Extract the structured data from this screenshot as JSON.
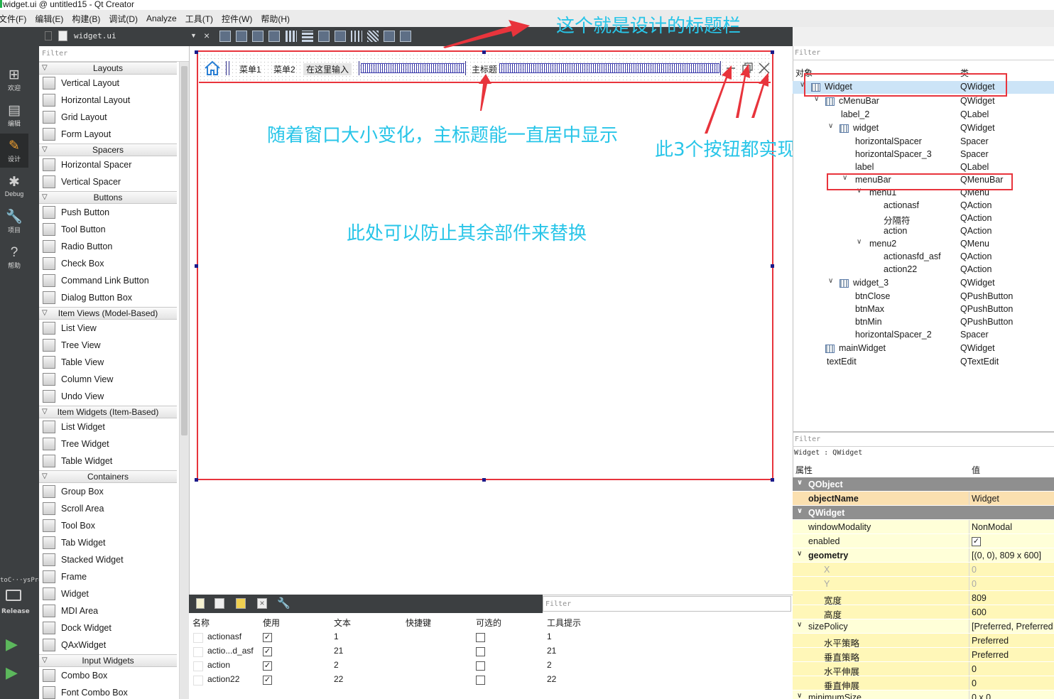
{
  "window": {
    "title": "widget.ui @ untitled15 - Qt Creator"
  },
  "menu": [
    "文件(F)",
    "编辑(E)",
    "构建(B)",
    "调试(D)",
    "Analyze",
    "工具(T)",
    "控件(W)",
    "帮助(H)"
  ],
  "modes": [
    {
      "label": "欢迎",
      "icon": "grid-icon"
    },
    {
      "label": "编辑",
      "icon": "edit-icon"
    },
    {
      "label": "设计",
      "icon": "design-pencil-icon"
    },
    {
      "label": "Debug",
      "icon": "bug-icon"
    },
    {
      "label": "项目",
      "icon": "wrench-icon"
    },
    {
      "label": "帮助",
      "icon": "help-icon"
    }
  ],
  "kit": {
    "name": "toC···ysPro",
    "config": "Release"
  },
  "toolbar": {
    "filename": "widget.ui"
  },
  "widget_box": {
    "filter_placeholder": "Filter",
    "categories": [
      {
        "name": "Layouts",
        "items": [
          "Vertical Layout",
          "Horizontal Layout",
          "Grid Layout",
          "Form Layout"
        ]
      },
      {
        "name": "Spacers",
        "items": [
          "Horizontal Spacer",
          "Vertical Spacer"
        ]
      },
      {
        "name": "Buttons",
        "items": [
          "Push Button",
          "Tool Button",
          "Radio Button",
          "Check Box",
          "Command Link Button",
          "Dialog Button Box"
        ]
      },
      {
        "name": "Item Views (Model-Based)",
        "items": [
          "List View",
          "Tree View",
          "Table View",
          "Column View",
          "Undo View"
        ]
      },
      {
        "name": "Item Widgets (Item-Based)",
        "items": [
          "List Widget",
          "Tree Widget",
          "Table Widget"
        ]
      },
      {
        "name": "Containers",
        "items": [
          "Group Box",
          "Scroll Area",
          "Tool Box",
          "Tab Widget",
          "Stacked Widget",
          "Frame",
          "Widget",
          "MDI Area",
          "Dock Widget",
          "QAxWidget"
        ]
      },
      {
        "name": "Input Widgets",
        "items": [
          "Combo Box",
          "Font Combo Box"
        ]
      }
    ]
  },
  "form": {
    "menu1": "菜单1",
    "menu2": "菜单2",
    "type_here": "在这里输入",
    "main_title": "主标题"
  },
  "annotations": {
    "title_bar": "这个就是设计的标题栏",
    "centered": "随着窗口大小变化，主标题能一直居中显示",
    "three_buttons": "此3个按钮都实现",
    "prevent_replace": "此处可以防止其余部件来替换"
  },
  "action_editor": {
    "filter_placeholder": "Filter",
    "headers": [
      "名称",
      "使用",
      "文本",
      "快捷键",
      "可选的",
      "工具提示"
    ],
    "rows": [
      {
        "name": "actionasf",
        "used": true,
        "text": "1",
        "shortcut": "",
        "checkable": false,
        "tooltip": "1"
      },
      {
        "name": "actio...d_asf",
        "used": true,
        "text": "21",
        "shortcut": "",
        "checkable": false,
        "tooltip": "21"
      },
      {
        "name": "action",
        "used": true,
        "text": "2",
        "shortcut": "",
        "checkable": false,
        "tooltip": "2"
      },
      {
        "name": "action22",
        "used": true,
        "text": "22",
        "shortcut": "",
        "checkable": false,
        "tooltip": "22"
      }
    ]
  },
  "object_inspector": {
    "filter_placeholder": "Filter",
    "headers": [
      "对象",
      "类"
    ],
    "rows": [
      {
        "name": "Widget",
        "cls": "QWidget",
        "depth": 0,
        "icon": true,
        "expand": "v"
      },
      {
        "name": "cMenuBar",
        "cls": "QWidget",
        "depth": 1,
        "icon": true,
        "expand": "v"
      },
      {
        "name": "label_2",
        "cls": "QLabel",
        "depth": 2,
        "icon": false,
        "expand": ""
      },
      {
        "name": "widget",
        "cls": "QWidget",
        "depth": 2,
        "icon": true,
        "expand": "v"
      },
      {
        "name": "horizontalSpacer",
        "cls": "Spacer",
        "depth": 3,
        "icon": false,
        "expand": ""
      },
      {
        "name": "horizontalSpacer_3",
        "cls": "Spacer",
        "depth": 3,
        "icon": false,
        "expand": ""
      },
      {
        "name": "label",
        "cls": "QLabel",
        "depth": 3,
        "icon": false,
        "expand": ""
      },
      {
        "name": "menuBar",
        "cls": "QMenuBar",
        "depth": 3,
        "icon": false,
        "expand": "v"
      },
      {
        "name": "menu1",
        "cls": "QMenu",
        "depth": 4,
        "icon": false,
        "expand": "v"
      },
      {
        "name": "actionasf",
        "cls": "QAction",
        "depth": 5,
        "icon": false,
        "expand": ""
      },
      {
        "name": "分隔符",
        "cls": "QAction",
        "depth": 5,
        "icon": false,
        "expand": ""
      },
      {
        "name": "action",
        "cls": "QAction",
        "depth": 5,
        "icon": false,
        "expand": ""
      },
      {
        "name": "menu2",
        "cls": "QMenu",
        "depth": 4,
        "icon": false,
        "expand": "v"
      },
      {
        "name": "actionasfd_asf",
        "cls": "QAction",
        "depth": 5,
        "icon": false,
        "expand": ""
      },
      {
        "name": "action22",
        "cls": "QAction",
        "depth": 5,
        "icon": false,
        "expand": ""
      },
      {
        "name": "widget_3",
        "cls": "QWidget",
        "depth": 2,
        "icon": true,
        "expand": "v"
      },
      {
        "name": "btnClose",
        "cls": "QPushButton",
        "depth": 3,
        "icon": false,
        "expand": ""
      },
      {
        "name": "btnMax",
        "cls": "QPushButton",
        "depth": 3,
        "icon": false,
        "expand": ""
      },
      {
        "name": "btnMin",
        "cls": "QPushButton",
        "depth": 3,
        "icon": false,
        "expand": ""
      },
      {
        "name": "horizontalSpacer_2",
        "cls": "Spacer",
        "depth": 3,
        "icon": false,
        "expand": ""
      },
      {
        "name": "mainWidget",
        "cls": "QWidget",
        "depth": 1,
        "icon": true,
        "expand": ""
      },
      {
        "name": "textEdit",
        "cls": "QTextEdit",
        "depth": 1,
        "icon": false,
        "expand": ""
      }
    ]
  },
  "property_editor": {
    "filter_placeholder": "Filter",
    "class_line": "Widget : QWidget",
    "headers": [
      "属性",
      "值"
    ],
    "rows": [
      {
        "name": "QObject",
        "value": "",
        "kind": "group"
      },
      {
        "name": "objectName",
        "value": "Widget",
        "kind": "orange",
        "bold": true
      },
      {
        "name": "QWidget",
        "value": "",
        "kind": "group"
      },
      {
        "name": "windowModality",
        "value": "NonModal",
        "kind": "yellow"
      },
      {
        "name": "enabled",
        "value": "✓",
        "kind": "yellow",
        "check": true
      },
      {
        "name": "geometry",
        "value": "[(0, 0), 809 x 600]",
        "kind": "yellow",
        "bold": true,
        "expand": "v"
      },
      {
        "name": "X",
        "value": "0",
        "kind": "yellow2",
        "sub": true,
        "dim": true
      },
      {
        "name": "Y",
        "value": "0",
        "kind": "yellow2",
        "sub": true,
        "dim": true
      },
      {
        "name": "宽度",
        "value": "809",
        "kind": "yellow2",
        "sub": true
      },
      {
        "name": "高度",
        "value": "600",
        "kind": "yellow2",
        "sub": true
      },
      {
        "name": "sizePolicy",
        "value": "[Preferred, Preferred",
        "kind": "yellow",
        "expand": "v"
      },
      {
        "name": "水平策略",
        "value": "Preferred",
        "kind": "yellow2",
        "sub": true
      },
      {
        "name": "垂直策略",
        "value": "Preferred",
        "kind": "yellow2",
        "sub": true
      },
      {
        "name": "水平伸展",
        "value": "0",
        "kind": "yellow2",
        "sub": true
      },
      {
        "name": "垂直伸展",
        "value": "0",
        "kind": "yellow2",
        "sub": true
      },
      {
        "name": "minimumSize",
        "value": "0 x 0",
        "kind": "yellow",
        "expand": "v"
      }
    ]
  }
}
